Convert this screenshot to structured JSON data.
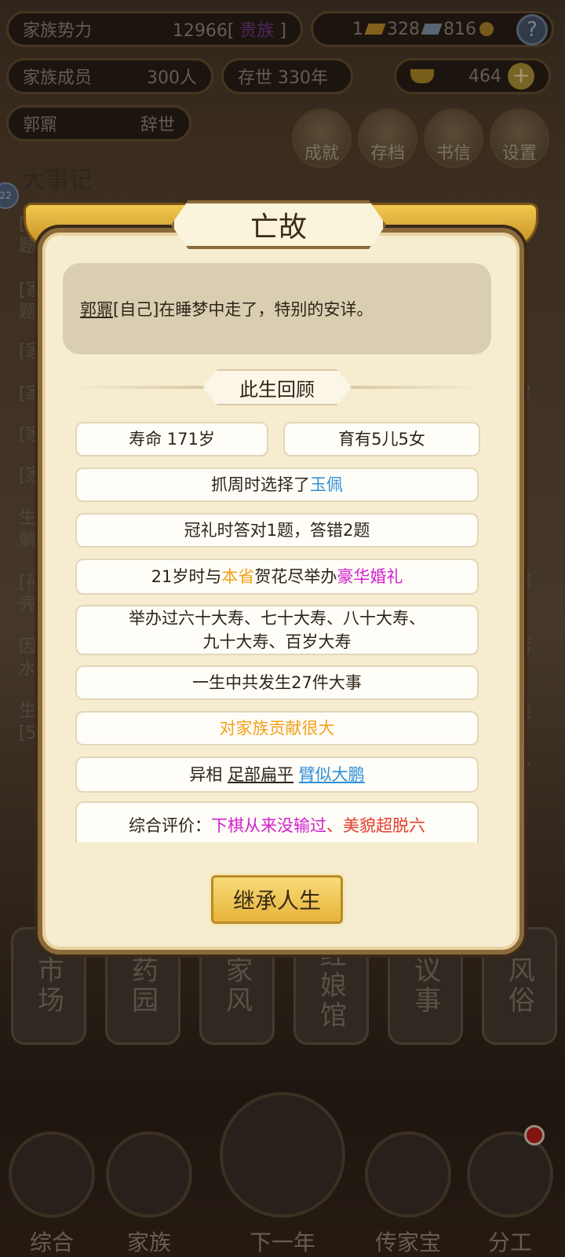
{
  "status_bar": {
    "family_power_label": "家族势力",
    "family_power_value": "12966",
    "family_power_rank": "贵族",
    "gold_bars": "1",
    "silver_value": "328",
    "coins_value": "816",
    "family_members_label": "家族成员",
    "family_members_value": "300人",
    "age_label": "存世",
    "age_value": "330年",
    "ingots_value": "464",
    "head_name": "郭鼏",
    "head_status": "辞世"
  },
  "top_buttons": [
    "成就",
    "存档",
    "书信",
    "设置"
  ],
  "chronicle": {
    "title": "大事记",
    "badge": "22",
    "left_fragments": [
      "[",
      "题",
      "[家",
      "题",
      "[家",
      "[家",
      "[家",
      "[家",
      "生",
      "躺",
      "[孙",
      "壳",
      "因",
      "水",
      "生",
      "[5"
    ],
    "right_fragments": [
      "贺",
      "]",
      "嫡",
      "落",
      "贱",
      "冬"
    ]
  },
  "bottom_cards": [
    "市场",
    "药园",
    "家风",
    "红娘馆",
    "议事",
    "风俗"
  ],
  "bottom_nav": [
    "综合",
    "家族",
    "下一年",
    "传家宝",
    "分工"
  ],
  "dialog": {
    "title": "亡故",
    "message_name": "郭鼏",
    "message_rest": "[自己]在睡梦中走了，特别的安详。",
    "review_label": "此生回顾",
    "lifespan": "寿命 171岁",
    "children": "育有5儿5女",
    "zhuazhou_prefix": "抓周时选择了",
    "zhuazhou_item": "玉佩",
    "guanli": "冠礼时答对1题，答错2题",
    "wedding_prefix": "21岁时与",
    "wedding_place": "本省",
    "wedding_mid": "贺花尽举办",
    "wedding_type": "豪华婚礼",
    "birthdays_line1": "举办过六十大寿、七十大寿、八十大寿、",
    "birthdays_line2": "九十大寿、百岁大寿",
    "events": "一生中共发生27件大事",
    "contribution": "对家族贡献很大",
    "appearance_prefix": "异相",
    "appearance_1": "足部扁平",
    "appearance_2": "臂似大鹏",
    "evaluation_label": "综合评价：",
    "evaluation_1": "下棋从来没输过",
    "evaluation_sep": "、",
    "evaluation_2": "美貌超脱六",
    "inherit_button": "继承人生"
  },
  "colors": {
    "link_blue": "#2f8ed8",
    "highlight_orange": "#f0a21c",
    "highlight_magenta": "#d21fd0",
    "highlight_red": "#e53a2a"
  }
}
